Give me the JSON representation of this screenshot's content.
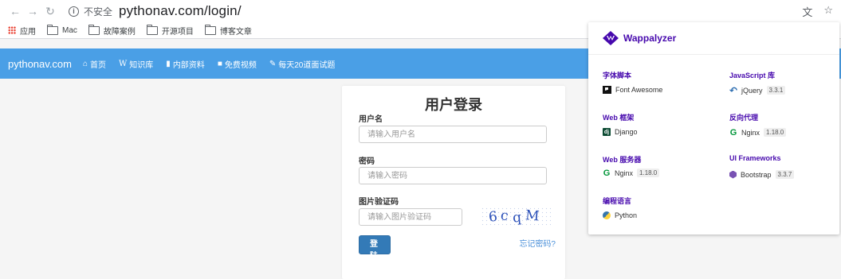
{
  "browser": {
    "insecure_label": "不安全",
    "url": "pythonav.com/login/"
  },
  "bookmarks": [
    {
      "label": "应用",
      "icon": "apps-grid-icon"
    },
    {
      "label": "Mac",
      "icon": "folder-icon"
    },
    {
      "label": "故障案例",
      "icon": "folder-icon"
    },
    {
      "label": "开源项目",
      "icon": "folder-icon"
    },
    {
      "label": "博客文章",
      "icon": "folder-icon"
    }
  ],
  "site_nav": {
    "brand": "pythonav.com",
    "items": [
      {
        "label": "首页",
        "icon": "home-icon"
      },
      {
        "label": "知识库",
        "icon": "wikipedia-w-icon"
      },
      {
        "label": "内部资料",
        "icon": "book-icon"
      },
      {
        "label": "免费视频",
        "icon": "video-camera-icon"
      },
      {
        "label": "每天20道面试题",
        "icon": "pencil-icon"
      }
    ]
  },
  "login": {
    "title": "用户登录",
    "username_label": "用户名",
    "username_placeholder": "请输入用户名",
    "password_label": "密码",
    "password_placeholder": "请输入密码",
    "captcha_label": "图片验证码",
    "captcha_placeholder": "请输入图片验证码",
    "captcha_chars": [
      "6",
      "c",
      "q",
      "M"
    ],
    "submit_label": "登 陆",
    "forgot_label": "忘记密码?"
  },
  "wappalyzer": {
    "title": "Wappalyzer",
    "categories": [
      {
        "name": "字体脚本",
        "tech": {
          "name": "Font Awesome",
          "version": "",
          "icon": "font-awesome-flag-icon"
        }
      },
      {
        "name": "JavaScript 库",
        "tech": {
          "name": "jQuery",
          "version": "3.3.1",
          "icon": "jquery-icon"
        }
      },
      {
        "name": "Web 框架",
        "tech": {
          "name": "Django",
          "version": "",
          "icon": "django-icon"
        }
      },
      {
        "name": "反向代理",
        "tech": {
          "name": "Nginx",
          "version": "1.18.0",
          "icon": "nginx-icon"
        }
      },
      {
        "name": "Web 服务器",
        "tech": {
          "name": "Nginx",
          "version": "1.18.0",
          "icon": "nginx-icon"
        }
      },
      {
        "name": "UI Frameworks",
        "tech": {
          "name": "Bootstrap",
          "version": "3.3.7",
          "icon": "bootstrap-icon"
        }
      },
      {
        "name": "编程语言",
        "tech": {
          "name": "Python",
          "version": "",
          "icon": "python-icon"
        }
      }
    ]
  },
  "colors": {
    "nav_bg": "#4a9fe6",
    "primary_button": "#337ab7",
    "wappalyzer_accent": "#4608ad",
    "captcha_text": "#2a4fb8"
  }
}
